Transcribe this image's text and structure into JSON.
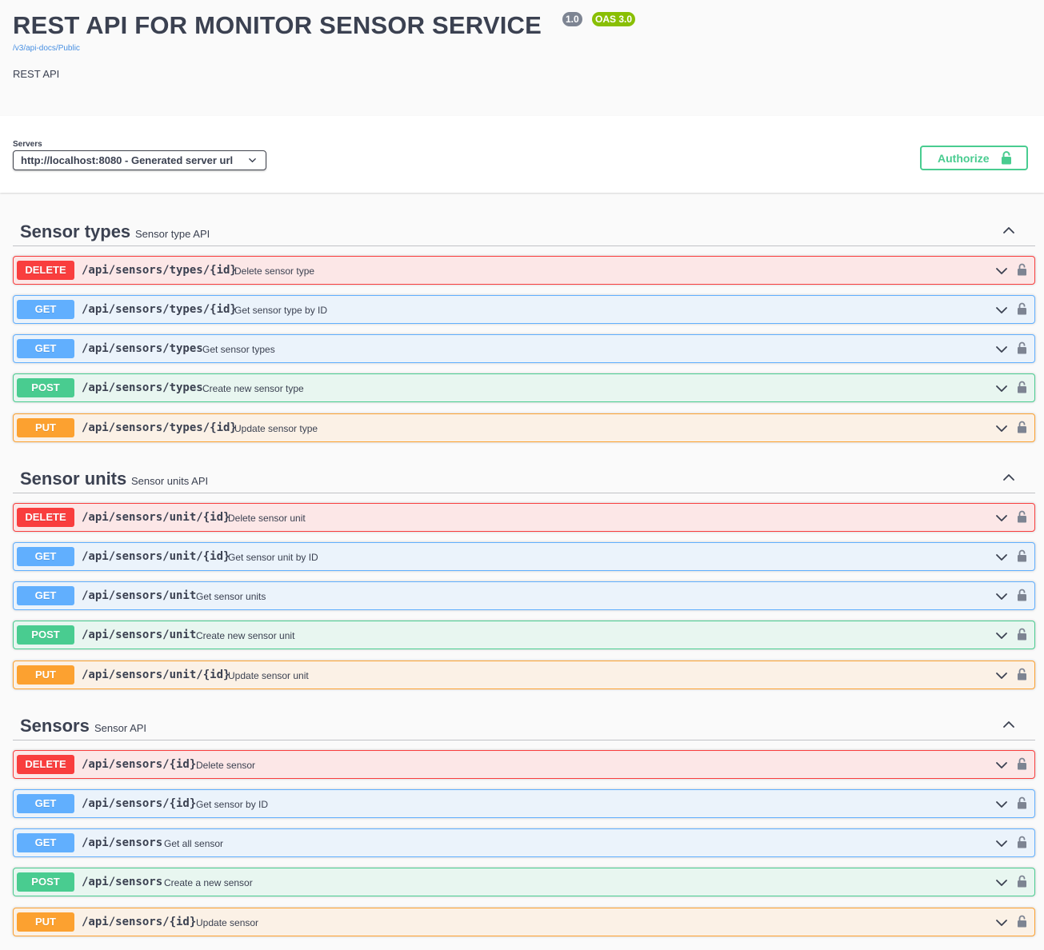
{
  "info": {
    "title": "REST API FOR MONITOR SENSOR SERVICE",
    "version": "1.0",
    "oas": "OAS 3.0",
    "docs_link": "/v3/api-docs/Public",
    "description": "REST API"
  },
  "servers": {
    "label": "Servers",
    "selected": "http://localhost:8080 - Generated server url"
  },
  "authorize": {
    "label": "Authorize"
  },
  "colors": {
    "delete": "#f93e3e",
    "get": "#61affe",
    "post": "#49cc90",
    "put": "#fca130",
    "lock": "#7d8492"
  },
  "icons": [
    "chevron-down-icon",
    "chevron-up-icon",
    "lock-icon"
  ],
  "tags": [
    {
      "name": "Sensor types",
      "description": "Sensor type API",
      "operations": [
        {
          "method": "DELETE",
          "path": "/api/sensors/types/{id}",
          "summary": "Delete sensor type"
        },
        {
          "method": "GET",
          "path": "/api/sensors/types/{id}",
          "summary": "Get sensor type by ID"
        },
        {
          "method": "GET",
          "path": "/api/sensors/types",
          "summary": "Get sensor types"
        },
        {
          "method": "POST",
          "path": "/api/sensors/types",
          "summary": "Create new sensor type"
        },
        {
          "method": "PUT",
          "path": "/api/sensors/types/{id}",
          "summary": "Update sensor type"
        }
      ]
    },
    {
      "name": "Sensor units",
      "description": "Sensor units API",
      "operations": [
        {
          "method": "DELETE",
          "path": "/api/sensors/unit/{id}",
          "summary": "Delete sensor unit"
        },
        {
          "method": "GET",
          "path": "/api/sensors/unit/{id}",
          "summary": "Get sensor unit by ID"
        },
        {
          "method": "GET",
          "path": "/api/sensors/unit",
          "summary": "Get sensor units"
        },
        {
          "method": "POST",
          "path": "/api/sensors/unit",
          "summary": "Create new sensor unit"
        },
        {
          "method": "PUT",
          "path": "/api/sensors/unit/{id}",
          "summary": "Update sensor unit"
        }
      ]
    },
    {
      "name": "Sensors",
      "description": "Sensor API",
      "operations": [
        {
          "method": "DELETE",
          "path": "/api/sensors/{id}",
          "summary": "Delete sensor"
        },
        {
          "method": "GET",
          "path": "/api/sensors/{id}",
          "summary": "Get sensor by ID"
        },
        {
          "method": "GET",
          "path": "/api/sensors",
          "summary": "Get all sensor"
        },
        {
          "method": "POST",
          "path": "/api/sensors",
          "summary": "Create a new sensor"
        },
        {
          "method": "PUT",
          "path": "/api/sensors/{id}",
          "summary": "Update sensor"
        }
      ]
    }
  ]
}
